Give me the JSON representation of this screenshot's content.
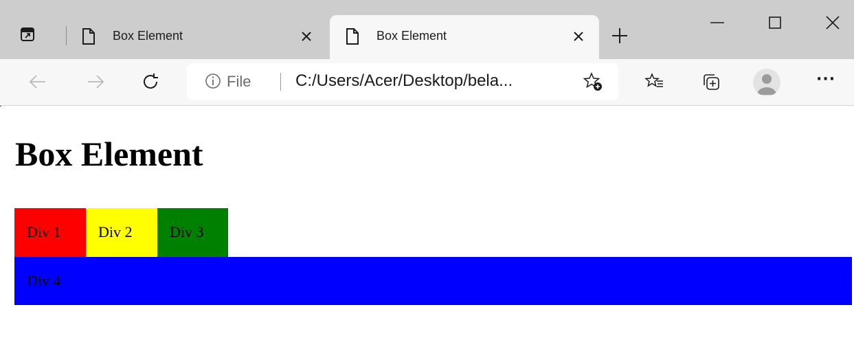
{
  "browser": {
    "tabs": [
      {
        "title": "Box Element",
        "active": false
      },
      {
        "title": "Box Element",
        "active": true
      }
    ],
    "address_bar": {
      "scheme_label": "File",
      "url": "C:/Users/Acer/Desktop/bela..."
    },
    "icons": {
      "tab_actions": "tab-actions-icon",
      "page": "page-icon",
      "close": "close-icon",
      "new_tab": "plus-icon",
      "back": "back-arrow-icon",
      "forward": "forward-arrow-icon",
      "reload": "reload-icon",
      "info": "info-icon",
      "add_favorite": "star-plus-icon",
      "favorites": "favorites-icon",
      "collections": "collections-icon",
      "profile": "avatar",
      "more": "more-icon"
    },
    "more_label": "···"
  },
  "page": {
    "heading": "Box Element",
    "boxes": [
      {
        "label": "Div 1",
        "color": "#ff0000"
      },
      {
        "label": "Div 2",
        "color": "#ffff00"
      },
      {
        "label": "Div 3",
        "color": "#008000"
      },
      {
        "label": "Div 4",
        "color": "#0000ff"
      }
    ]
  }
}
